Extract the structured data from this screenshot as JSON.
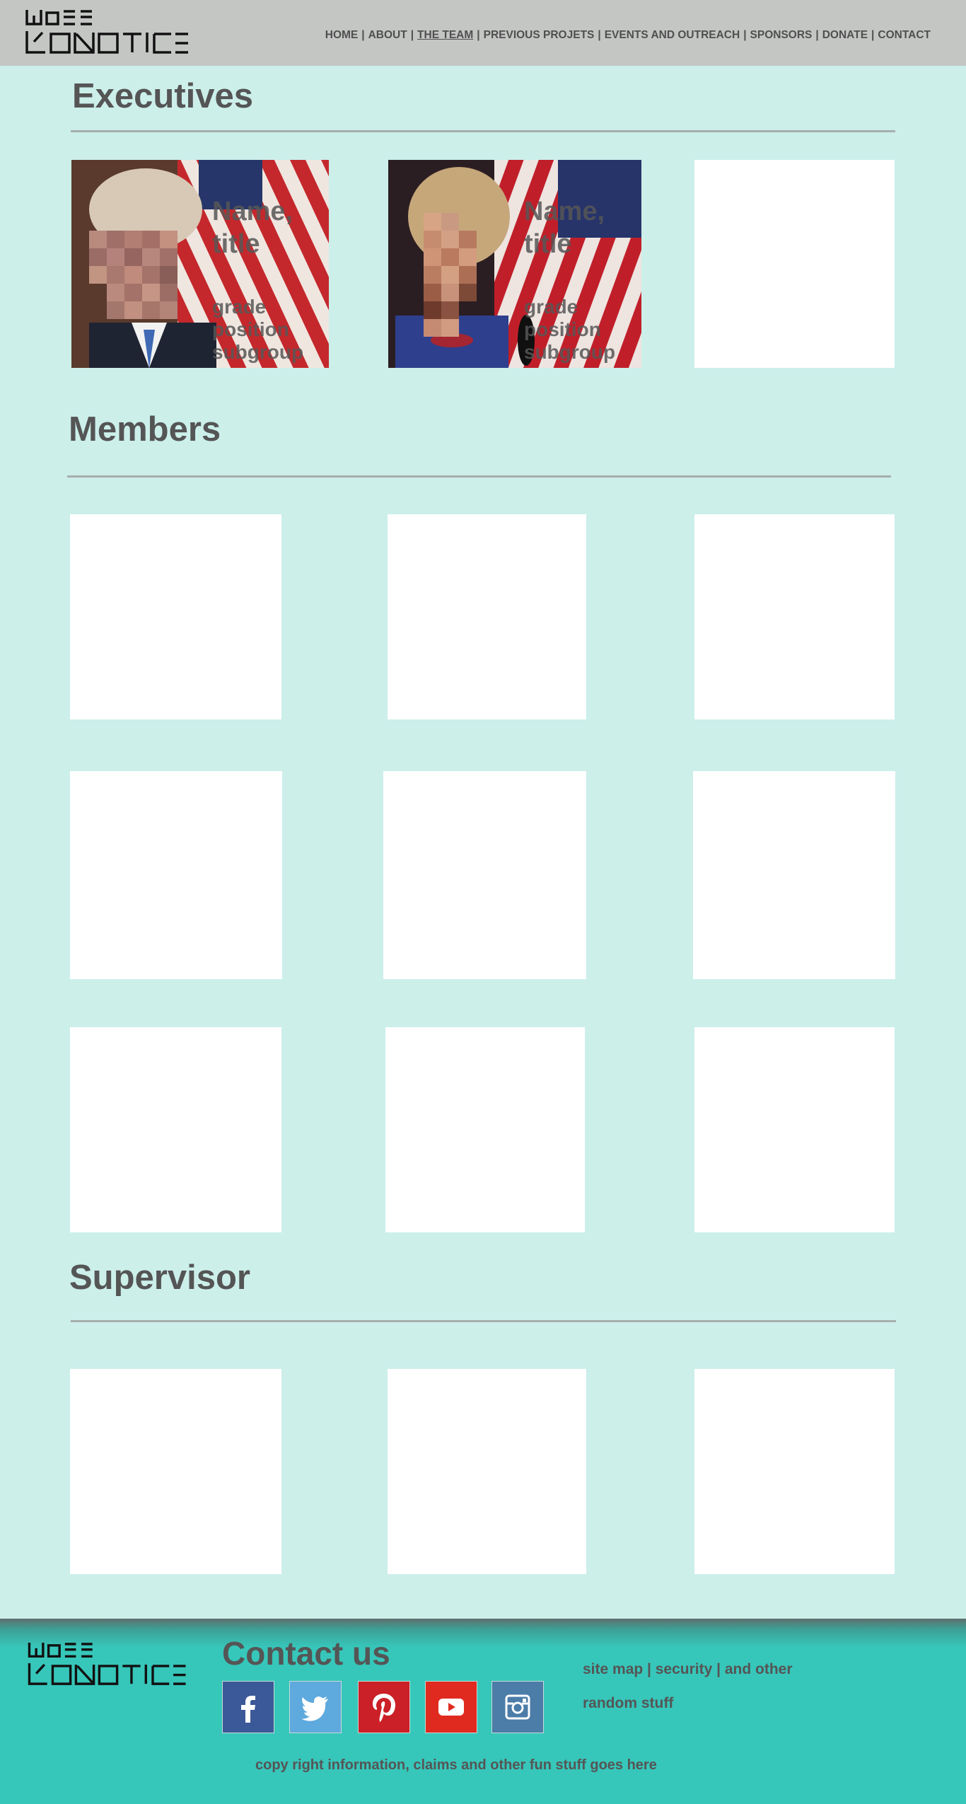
{
  "header": {
    "nav": [
      {
        "label": "HOME",
        "active": false
      },
      {
        "label": "ABOUT",
        "active": false
      },
      {
        "label": "THE TEAM",
        "active": true
      },
      {
        "label": "PREVIOUS PROJETS",
        "active": false
      },
      {
        "label": "EVENTS AND OUTREACH",
        "active": false
      },
      {
        "label": "SPONSORS",
        "active": false
      },
      {
        "label": "DONATE",
        "active": false
      },
      {
        "label": "CONTACT",
        "active": false
      }
    ],
    "separator": "|"
  },
  "executives": {
    "title": "Executives",
    "cards": [
      {
        "name": "Name,",
        "title": "title",
        "info": [
          "grade",
          "position",
          "subgroup"
        ]
      },
      {
        "name": "Name,",
        "title": "title",
        "info": [
          "grade",
          "position",
          "subgroup"
        ]
      }
    ]
  },
  "members": {
    "title": "Members"
  },
  "supervisor": {
    "title": "Supervisor"
  },
  "footer": {
    "contact_title": "Contact us",
    "social_icons": [
      "facebook-icon",
      "twitter-icon",
      "pinterest-icon",
      "youtube-icon",
      "instagram-icon"
    ],
    "links_line1": "site map | security | and other",
    "links_line2": "random stuff",
    "copyright": "copy right information, claims and other fun stuff goes here"
  },
  "colors": {
    "background": "#ccefea",
    "header": "#c4c6c4",
    "footer": "#37c6ba",
    "facebook": "#3b5998",
    "twitter": "#5ea9dd",
    "pinterest": "#cb2027",
    "youtube": "#e02a20",
    "instagram": "#4c7ca8"
  }
}
